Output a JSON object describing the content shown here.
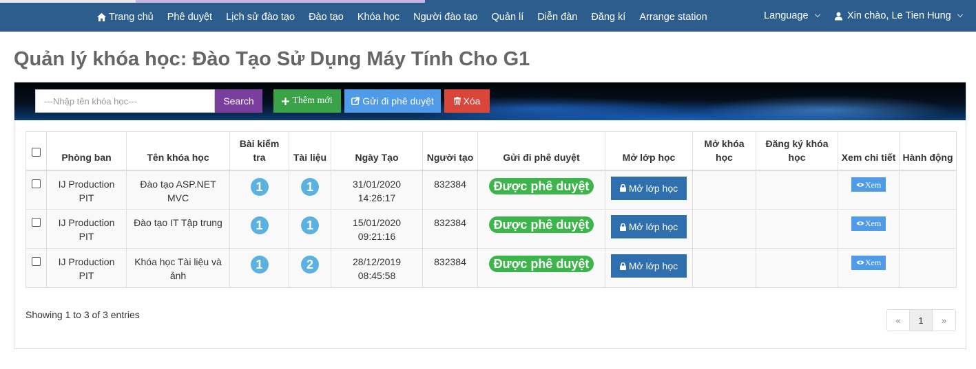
{
  "nav": {
    "items": [
      "Trang chủ",
      "Phê duyệt",
      "Lịch sử đào tạo",
      "Đào tạo",
      "Khóa học",
      "Người đào tạo",
      "Quản lí",
      "Diễn đàn",
      "Đăng kí",
      "Arrange station"
    ],
    "home_icon": "home-icon",
    "language_label": "Language",
    "user_greeting": "Xin chào, Le Tien Hung",
    "user_icon": "user-icon",
    "background_color": "#2d5d8c"
  },
  "page": {
    "title": "Quản lý khóa học: Đào Tạo Sử Dụng Máy Tính Cho G1"
  },
  "toolbar": {
    "search_placeholder": "---Nhập tên khóa học---",
    "search_value": "",
    "search_label": "Search",
    "add_label": "Thêm mới",
    "send_label": "Gửi đi phê duyệt",
    "delete_label": "Xóa",
    "colors": {
      "search": "#7a3f9d",
      "add": "#3aa347",
      "send": "#4f9be8",
      "delete": "#d9463a"
    }
  },
  "table": {
    "headers": [
      "",
      "Phòng ban",
      "Tên khóa học",
      "Bài kiểm tra",
      "Tài liệu",
      "Ngày Tạo",
      "Người tạo",
      "Gửi đi phê duyệt",
      "Mở lớp học",
      "Mở khóa học",
      "Đăng ký khóa học",
      "Xem chi tiết",
      "Hành động"
    ],
    "rows": [
      {
        "department": "IJ Production PIT",
        "course": "Đào tạo ASP.NET MVC",
        "tests": "1",
        "docs": "1",
        "created_date": "31/01/2020",
        "created_time": "14:26:17",
        "creator": "832384",
        "approval": "Được phê duyệt",
        "open_class": "Mở lớp học",
        "view": "Xem"
      },
      {
        "department": "IJ Production PIT",
        "course": "Đào tạo IT Tập trung",
        "tests": "1",
        "docs": "1",
        "created_date": "15/01/2020",
        "created_time": "09:21:16",
        "creator": "832384",
        "approval": "Được phê duyệt",
        "open_class": "Mở lớp học",
        "view": "Xem"
      },
      {
        "department": "IJ Production PIT",
        "course": "Khóa học Tài liệu và ảnh",
        "tests": "1",
        "docs": "2",
        "created_date": "28/12/2019",
        "created_time": "08:45:58",
        "creator": "832384",
        "approval": "Được phê duyệt",
        "open_class": "Mở lớp học",
        "view": "Xem"
      }
    ],
    "badge_color": "#5bb2e0",
    "approved_color": "#3cb54a"
  },
  "footer": {
    "info": "Showing 1 to 3 of 3 entries",
    "pager": {
      "prev": "«",
      "current": "1",
      "next": "»"
    }
  }
}
